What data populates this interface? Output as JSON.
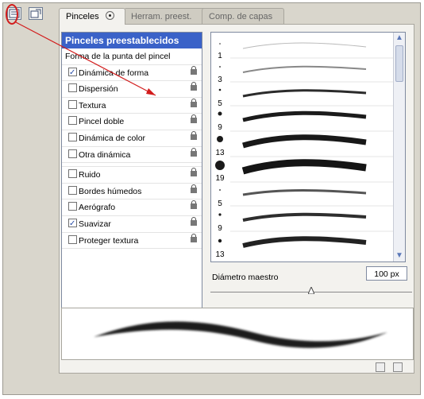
{
  "tabs": [
    {
      "label": "Pinceles"
    },
    {
      "label": "Herram. preest."
    },
    {
      "label": "Comp. de capas"
    }
  ],
  "brush_list": {
    "header": "Pinceles preestablecidos",
    "tip_shape": "Forma de la punta del pincel",
    "items": [
      {
        "label": "Dinámica de forma",
        "checked": true
      },
      {
        "label": "Dispersión",
        "checked": false
      },
      {
        "label": "Textura",
        "checked": false
      },
      {
        "label": "Pincel doble",
        "checked": false
      },
      {
        "label": "Dinámica de color",
        "checked": false
      },
      {
        "label": "Otra dinámica",
        "checked": false
      },
      {
        "label": "Ruido",
        "checked": false
      },
      {
        "label": "Bordes húmedos",
        "checked": false
      },
      {
        "label": "Aerógrafo",
        "checked": false
      },
      {
        "label": "Suavizar",
        "checked": true
      },
      {
        "label": "Proteger textura",
        "checked": false
      }
    ]
  },
  "brush_presets": {
    "sizes": [
      "1",
      "3",
      "5",
      "9",
      "13",
      "19",
      "5",
      "9",
      "13"
    ]
  },
  "master_diameter": {
    "label": "Diámetro maestro",
    "value": "100 px"
  },
  "colors": {
    "selection": "#3a62c8",
    "annotation": "#d21c1c"
  },
  "icons": [
    "brush-panel-icon",
    "dock-icon",
    "lock-icon",
    "new-brush-icon",
    "trash-icon",
    "scroll-up-icon",
    "scroll-down-icon"
  ]
}
